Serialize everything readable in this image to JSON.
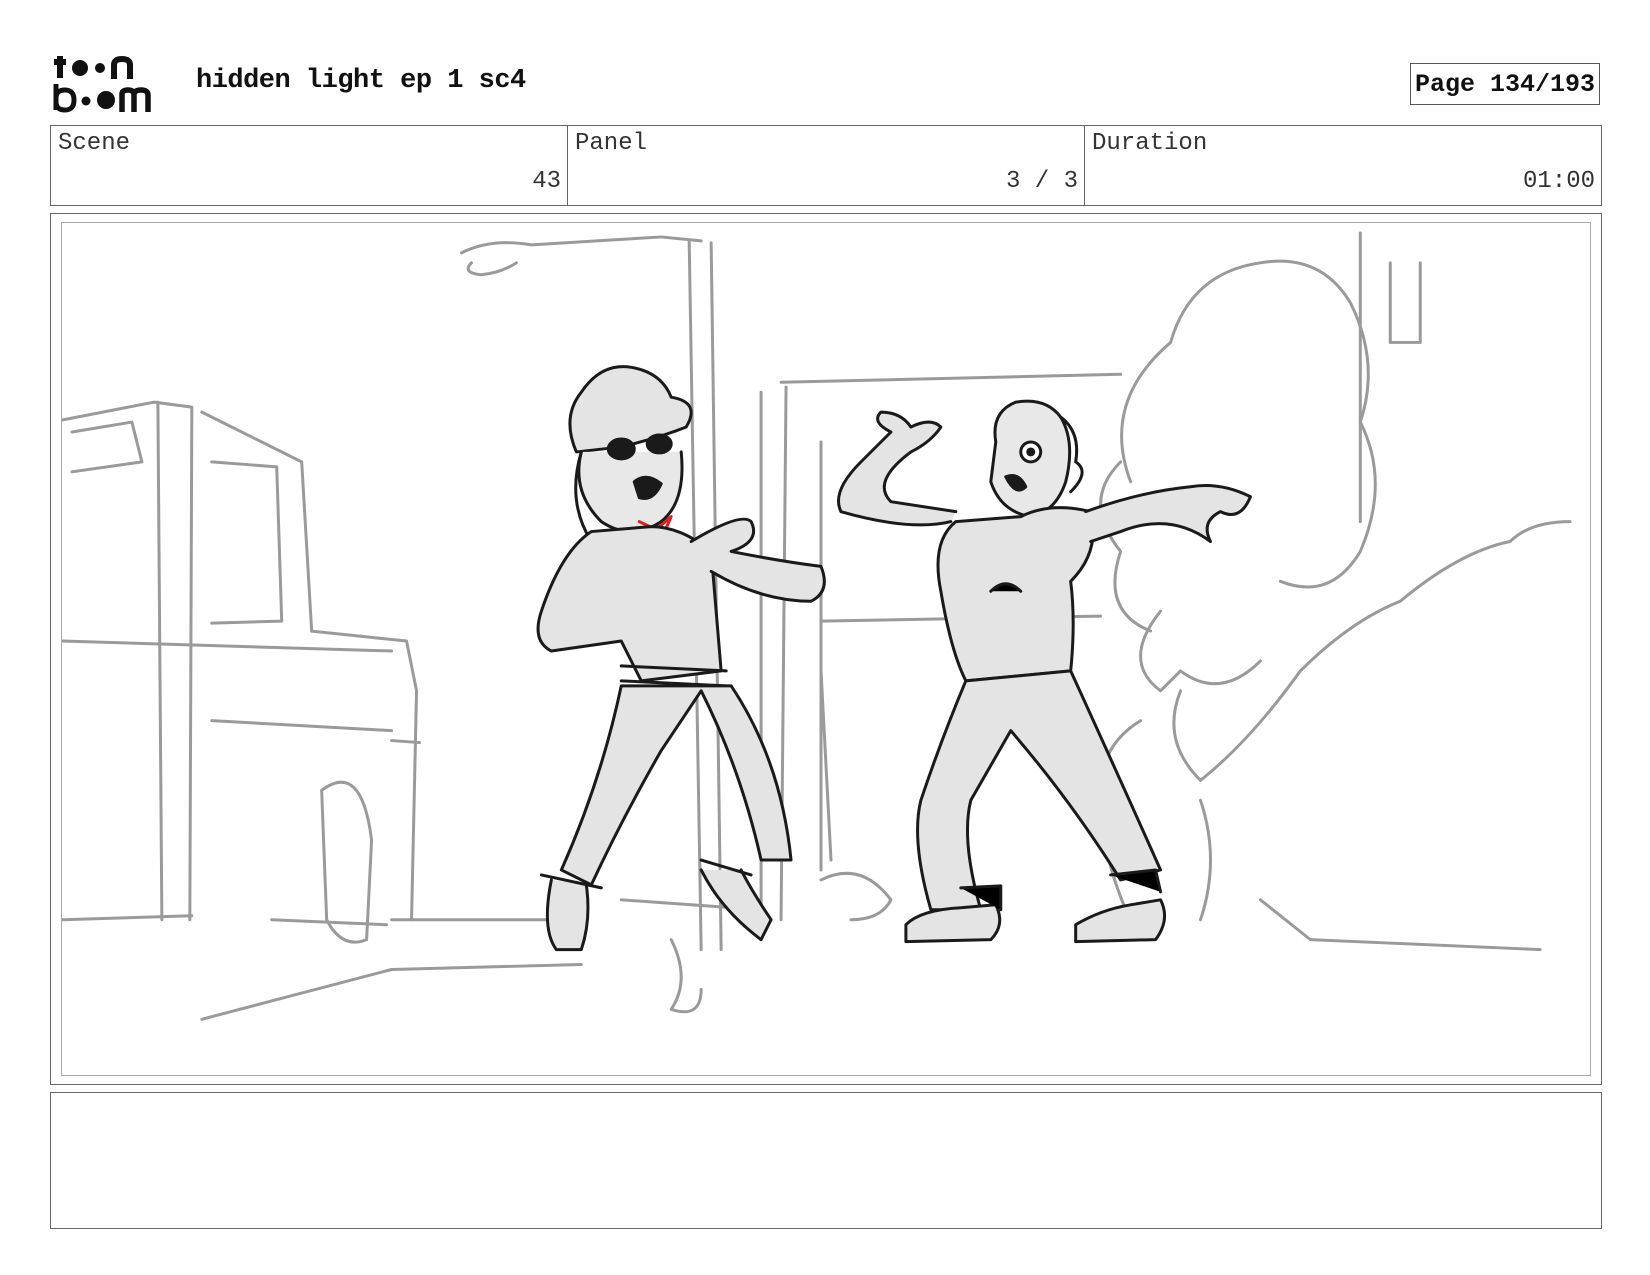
{
  "header": {
    "logo_alt": "toon boom",
    "title": "hidden light ep 1 sc4",
    "page_label": "Page 134/193"
  },
  "info": {
    "scene": {
      "label": "Scene",
      "value": "43"
    },
    "panel": {
      "label": "Panel",
      "value": "3 / 3"
    },
    "duration": {
      "label": "Duration",
      "value": "01:00"
    }
  },
  "notes": {
    "text": ""
  },
  "colors": {
    "border": "#666666",
    "sketch_gray": "#9a9a9a",
    "sketch_dark": "#1a1a1a",
    "fill_gray": "#e4e4e4",
    "accent_red": "#e02020"
  }
}
